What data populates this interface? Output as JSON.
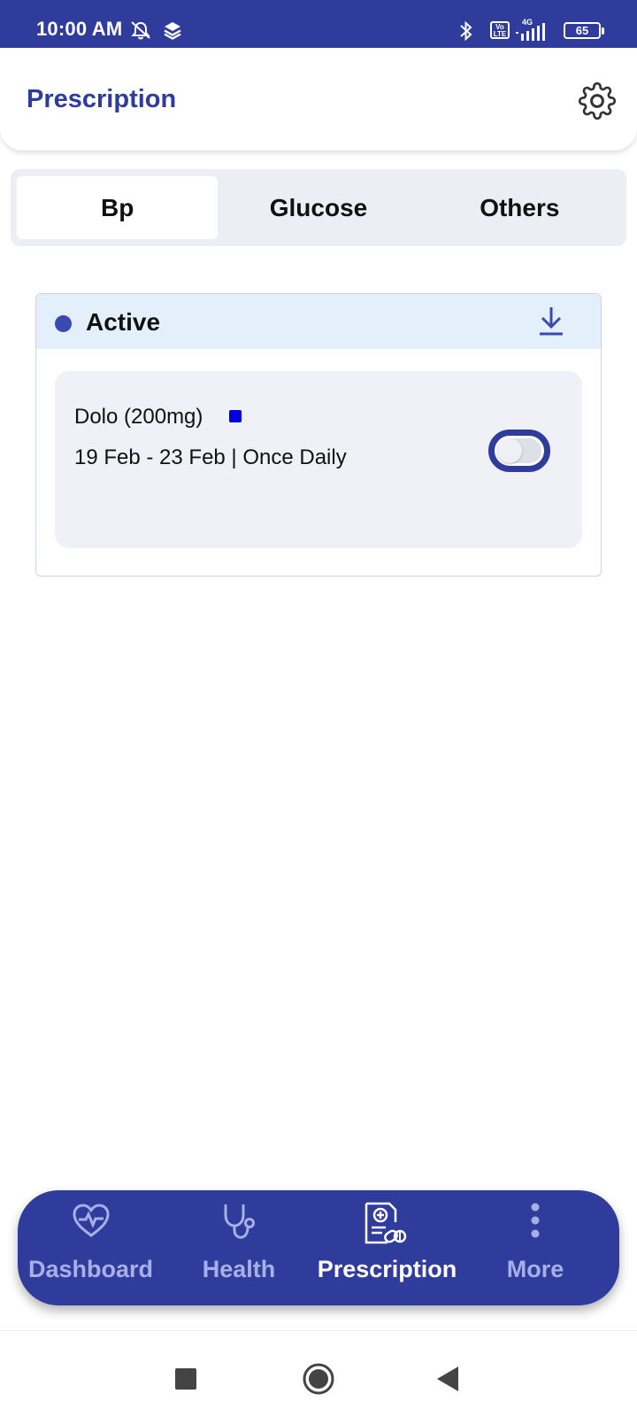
{
  "status_bar": {
    "time": "10:00 AM",
    "network": "4G",
    "volte": "Vo LTE",
    "battery": "65",
    "icons": [
      "alarm-off-icon",
      "layers-icon",
      "bluetooth-icon",
      "volte-icon",
      "signal-icon",
      "battery-icon"
    ]
  },
  "header": {
    "title": "Prescription",
    "settings_icon": "gear-icon"
  },
  "tabs": [
    {
      "label": "Bp",
      "selected": true
    },
    {
      "label": "Glucose",
      "selected": false
    },
    {
      "label": "Others",
      "selected": false
    }
  ],
  "active_section": {
    "label": "Active",
    "download_icon": "download-icon",
    "medication": {
      "name": "Dolo (200mg)",
      "schedule": "19 Feb - 23 Feb  | Once Daily",
      "marker_color": "#0000dd",
      "toggle_on": false
    }
  },
  "bottom_nav": [
    {
      "label": "Dashboard",
      "icon": "heart-pulse-icon",
      "active": false
    },
    {
      "label": "Health",
      "icon": "stethoscope-icon",
      "active": false
    },
    {
      "label": "Prescription",
      "icon": "prescription-icon",
      "active": true
    },
    {
      "label": "More",
      "icon": "more-vertical-icon",
      "active": false
    }
  ],
  "system_nav": [
    "recents-icon",
    "home-icon",
    "back-icon"
  ],
  "colors": {
    "brand": "#2f3c9c",
    "active_header_bg": "#e3effb",
    "card_bg": "#f0f0f7",
    "nav_inactive": "#a7b0e6"
  }
}
